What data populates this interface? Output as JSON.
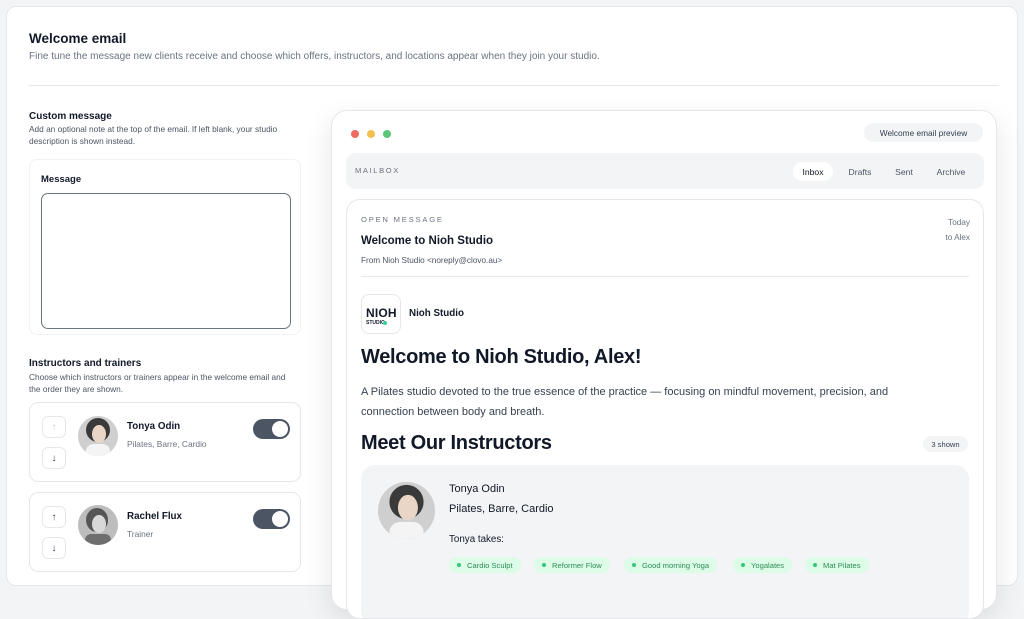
{
  "page": {
    "title": "Welcome email",
    "subtitle": "Fine tune the message new clients receive and choose which offers, instructors, and locations appear when they join your studio."
  },
  "custom_message": {
    "title": "Custom message",
    "description": "Add an optional note at the top of the email. If left blank, your studio description is shown instead.",
    "field_label": "Message",
    "value": "",
    "placeholder": ""
  },
  "instructors": {
    "title": "Instructors and trainers",
    "description": "Choose which instructors or trainers appear in the welcome email and the order they are shown.",
    "items": [
      {
        "name": "Tonya Odin",
        "meta": "Pilates, Barre, Cardio",
        "enabled": true
      },
      {
        "name": "Rachel Flux",
        "meta": "Trainer",
        "enabled": true
      }
    ]
  },
  "preview": {
    "badge": "Welcome email preview",
    "mailbox_label": "MAILBOX",
    "tabs": [
      "Inbox",
      "Drafts",
      "Sent",
      "Archive"
    ],
    "active_tab": "Inbox",
    "message": {
      "label": "OPEN MESSAGE",
      "subject": "Welcome to Nioh Studio",
      "from": "From Nioh Studio <noreply@clovo.au>",
      "date": "Today",
      "to": "to Alex",
      "logo_word": "NIOH",
      "logo_sub": "STUDIO",
      "studio_name": "Nioh Studio",
      "headline": "Welcome to Nioh Studio, Alex!",
      "description": "A Pilates studio devoted to the true essence of the practice — focusing on mindful movement, precision, and connection between body and breath.",
      "instructors_heading": "Meet Our Instructors",
      "shown_count": "3 shown",
      "featured": {
        "name": "Tonya Odin",
        "roles": "Pilates, Barre, Cardio",
        "takes_label": "Tonya takes:",
        "classes": [
          "Cardio Sculpt",
          "Reformer Flow",
          "Good morning Yoga",
          "Yogalates",
          "Mat Pilates"
        ]
      }
    }
  },
  "colors": {
    "toggle_on": "#4b5563",
    "accent_green": "#34d399",
    "pill_green_bg": "#dcfce7",
    "traffic_red": "#ef6b5f",
    "traffic_yellow": "#f3bf4f",
    "traffic_green": "#5fc579"
  },
  "icons": {
    "up": "arrow-up-icon",
    "down": "arrow-down-icon"
  }
}
